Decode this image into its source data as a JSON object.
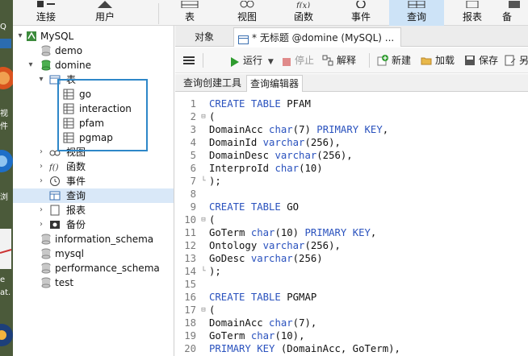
{
  "desktop": {
    "labels": [
      "Q",
      "视",
      "件",
      "浏",
      "e",
      "at."
    ]
  },
  "toolbar": {
    "items": [
      {
        "id": "connect",
        "label": "连接",
        "icon": "plug-icon"
      },
      {
        "id": "user",
        "label": "用户",
        "icon": "user-icon"
      },
      {
        "id": "table",
        "label": "表",
        "icon": "table-icon"
      },
      {
        "id": "view",
        "label": "视图",
        "icon": "view-icon"
      },
      {
        "id": "function",
        "label": "函数",
        "icon": "function-icon"
      },
      {
        "id": "event",
        "label": "事件",
        "icon": "event-icon"
      },
      {
        "id": "query",
        "label": "查询",
        "icon": "query-icon",
        "active": true
      },
      {
        "id": "report",
        "label": "报表",
        "icon": "report-icon"
      },
      {
        "id": "backup",
        "label": "备",
        "icon": "backup-icon"
      }
    ]
  },
  "tree": {
    "root": "MySQL",
    "db_demo": "demo",
    "db_domine": "domine",
    "tables_group": "表",
    "tables": [
      "go",
      "interaction",
      "pfam",
      "pgmap"
    ],
    "views": "视图",
    "functions": "函数",
    "events": "事件",
    "queries": "查询",
    "reports": "报表",
    "backups": "备份",
    "other_dbs": [
      "information_schema",
      "mysql",
      "performance_schema",
      "test"
    ]
  },
  "tabs": {
    "objects": "对象",
    "query_tab": "* 无标题 @domine (MySQL) ..."
  },
  "query_toolbar": {
    "run": "运行",
    "stop": "停止",
    "explain": "解释",
    "new": "新建",
    "load": "加载",
    "save": "保存",
    "save_as": "另"
  },
  "subtabs": {
    "builder": "查询创建工具",
    "editor": "查询编辑器"
  },
  "colors": {
    "keyword": "#2a52be",
    "active_tab": "#cde3f7",
    "selection": "#d9e8f8",
    "highlight_box": "#2e87c8"
  },
  "code_lines": [
    {
      "n": "1",
      "parts": [
        {
          "k": true,
          "t": "CREATE TABLE"
        },
        {
          "k": false,
          "t": " PFAM"
        }
      ]
    },
    {
      "n": "2",
      "fold": "⊟",
      "parts": [
        {
          "k": false,
          "t": "("
        }
      ]
    },
    {
      "n": "3",
      "parts": [
        {
          "k": false,
          "t": "DomainAcc "
        },
        {
          "k": true,
          "t": "char"
        },
        {
          "k": false,
          "t": "(7) "
        },
        {
          "k": true,
          "t": "PRIMARY KEY"
        },
        {
          "k": false,
          "t": ","
        }
      ]
    },
    {
      "n": "4",
      "parts": [
        {
          "k": false,
          "t": "DomainId "
        },
        {
          "k": true,
          "t": "varchar"
        },
        {
          "k": false,
          "t": "(256),"
        }
      ]
    },
    {
      "n": "5",
      "parts": [
        {
          "k": false,
          "t": "DomainDesc "
        },
        {
          "k": true,
          "t": "varchar"
        },
        {
          "k": false,
          "t": "(256),"
        }
      ]
    },
    {
      "n": "6",
      "parts": [
        {
          "k": false,
          "t": "InterproId "
        },
        {
          "k": true,
          "t": "char"
        },
        {
          "k": false,
          "t": "(10)"
        }
      ]
    },
    {
      "n": "7",
      "fold": "└",
      "parts": [
        {
          "k": false,
          "t": ");"
        }
      ]
    },
    {
      "n": "8",
      "parts": []
    },
    {
      "n": "9",
      "parts": [
        {
          "k": true,
          "t": "CREATE TABLE"
        },
        {
          "k": false,
          "t": " GO"
        }
      ]
    },
    {
      "n": "10",
      "fold": "⊟",
      "parts": [
        {
          "k": false,
          "t": "("
        }
      ]
    },
    {
      "n": "11",
      "parts": [
        {
          "k": false,
          "t": "GoTerm "
        },
        {
          "k": true,
          "t": "char"
        },
        {
          "k": false,
          "t": "(10) "
        },
        {
          "k": true,
          "t": "PRIMARY KEY"
        },
        {
          "k": false,
          "t": ","
        }
      ]
    },
    {
      "n": "12",
      "parts": [
        {
          "k": false,
          "t": "Ontology "
        },
        {
          "k": true,
          "t": "varchar"
        },
        {
          "k": false,
          "t": "(256),"
        }
      ]
    },
    {
      "n": "13",
      "parts": [
        {
          "k": false,
          "t": "GoDesc "
        },
        {
          "k": true,
          "t": "varchar"
        },
        {
          "k": false,
          "t": "(256)"
        }
      ]
    },
    {
      "n": "14",
      "fold": "└",
      "parts": [
        {
          "k": false,
          "t": ");"
        }
      ]
    },
    {
      "n": "15",
      "parts": []
    },
    {
      "n": "16",
      "parts": [
        {
          "k": true,
          "t": "CREATE TABLE"
        },
        {
          "k": false,
          "t": " PGMAP"
        }
      ]
    },
    {
      "n": "17",
      "fold": "⊟",
      "parts": [
        {
          "k": false,
          "t": "("
        }
      ]
    },
    {
      "n": "18",
      "parts": [
        {
          "k": false,
          "t": "DomainAcc "
        },
        {
          "k": true,
          "t": "char"
        },
        {
          "k": false,
          "t": "(7),"
        }
      ]
    },
    {
      "n": "19",
      "parts": [
        {
          "k": false,
          "t": "GoTerm "
        },
        {
          "k": true,
          "t": "char"
        },
        {
          "k": false,
          "t": "(10),"
        }
      ]
    },
    {
      "n": "20",
      "parts": [
        {
          "k": true,
          "t": "PRIMARY KEY"
        },
        {
          "k": false,
          "t": " (DomainAcc, GoTerm),"
        }
      ]
    }
  ]
}
